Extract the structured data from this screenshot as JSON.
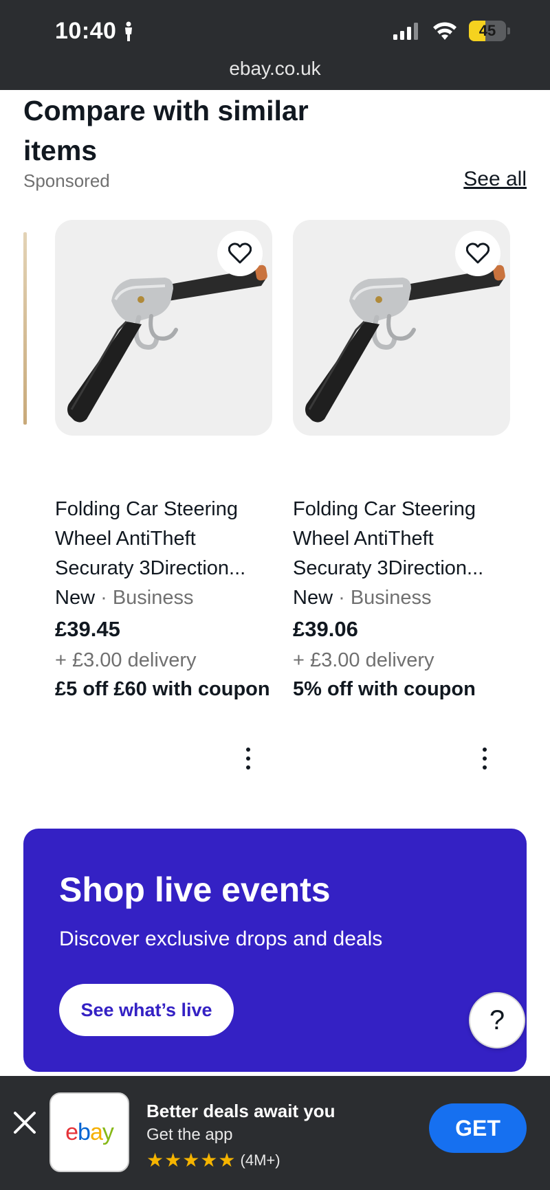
{
  "status_bar": {
    "time": "10:40",
    "battery_level": "45",
    "battery_fraction": 0.45,
    "url": "ebay.co.uk",
    "icons": [
      "person-icon",
      "signal-icon",
      "wifi-icon",
      "battery-icon"
    ]
  },
  "compare_section": {
    "title": "Compare with similar items",
    "sponsored": "Sponsored",
    "see_all": "See all",
    "items": [
      {
        "title": "Folding Car Steering Wheel AntiTheft Securaty 3Direction...",
        "condition": "New",
        "separator": "·",
        "seller_type": "Business",
        "price": "£39.45",
        "delivery": "+ £3.00 delivery",
        "coupon": "£5 off £60 with coupon"
      },
      {
        "title": "Folding Car Steering Wheel AntiTheft Securaty 3Direction...",
        "condition": "New",
        "separator": "·",
        "seller_type": "Business",
        "price": "£39.06",
        "delivery": "+ £3.00 delivery",
        "coupon": "5% off with coupon"
      }
    ]
  },
  "live_banner": {
    "title": "Shop live events",
    "subtitle": "Discover exclusive drops and deals",
    "button": "See what’s live",
    "background": "#3421c4"
  },
  "help_button": {
    "label": "?"
  },
  "app_banner": {
    "logo_text": {
      "e": "e",
      "b": "b",
      "a": "a",
      "y": "y"
    },
    "headline": "Better deals await you",
    "subtext": "Get the app",
    "stars": "★★★★★",
    "rating_count": "(4M+)",
    "get_button": "GET",
    "button_color": "#1670f0"
  }
}
